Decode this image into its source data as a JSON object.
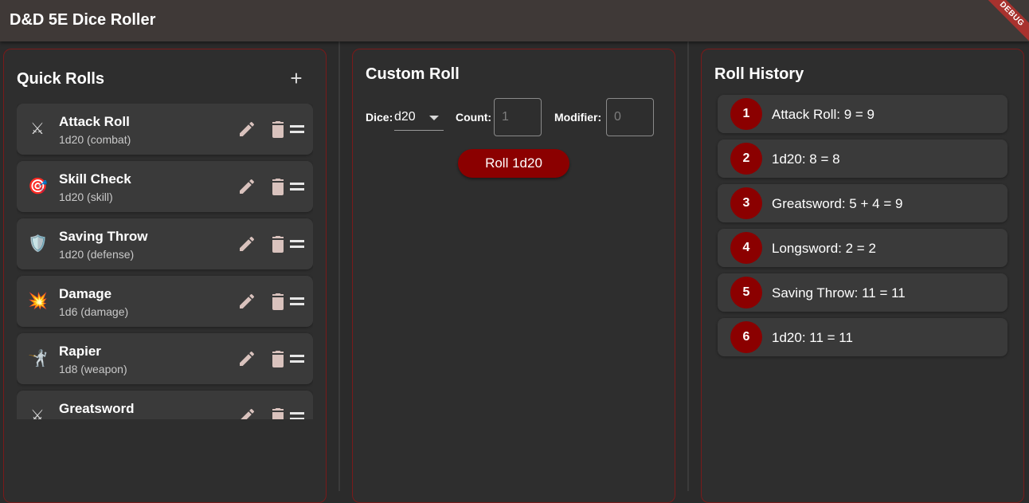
{
  "app": {
    "title": "D&D 5E Dice Roller",
    "debug_label": "DEBUG"
  },
  "colors": {
    "accent": "#8b0000",
    "panel_border": "#7a1a1a",
    "appbar": "#3f3937"
  },
  "quick_rolls": {
    "title": "Quick Rolls",
    "add_icon": "plus-icon",
    "add_glyph": "+",
    "items": [
      {
        "icon": "crossed-swords-icon",
        "glyph": "⚔",
        "name": "Attack Roll",
        "sub": "1d20 (combat)"
      },
      {
        "icon": "target-icon",
        "glyph": "🎯",
        "name": "Skill Check",
        "sub": "1d20 (skill)"
      },
      {
        "icon": "shield-icon",
        "glyph": "🛡️",
        "name": "Saving Throw",
        "sub": "1d20 (defense)"
      },
      {
        "icon": "explosion-icon",
        "glyph": "💥",
        "name": "Damage",
        "sub": "1d6 (damage)"
      },
      {
        "icon": "fencer-icon",
        "glyph": "🤺",
        "name": "Rapier",
        "sub": "1d8 (weapon)"
      },
      {
        "icon": "crossed-swords-icon",
        "glyph": "⚔",
        "name": "Greatsword",
        "sub": ""
      }
    ]
  },
  "custom_roll": {
    "title": "Custom Roll",
    "dice_label": "Dice:",
    "dice_value": "d20",
    "count_label": "Count:",
    "count_placeholder": "1",
    "modifier_label": "Modifier:",
    "modifier_placeholder": "0",
    "roll_button": "Roll 1d20"
  },
  "history": {
    "title": "Roll History",
    "items": [
      {
        "n": "1",
        "text": "Attack Roll: 9 = 9"
      },
      {
        "n": "2",
        "text": "1d20: 8 = 8"
      },
      {
        "n": "3",
        "text": "Greatsword: 5 + 4 = 9"
      },
      {
        "n": "4",
        "text": "Longsword: 2 = 2"
      },
      {
        "n": "5",
        "text": "Saving Throw: 11 = 11"
      },
      {
        "n": "6",
        "text": "1d20: 11 = 11"
      }
    ]
  }
}
